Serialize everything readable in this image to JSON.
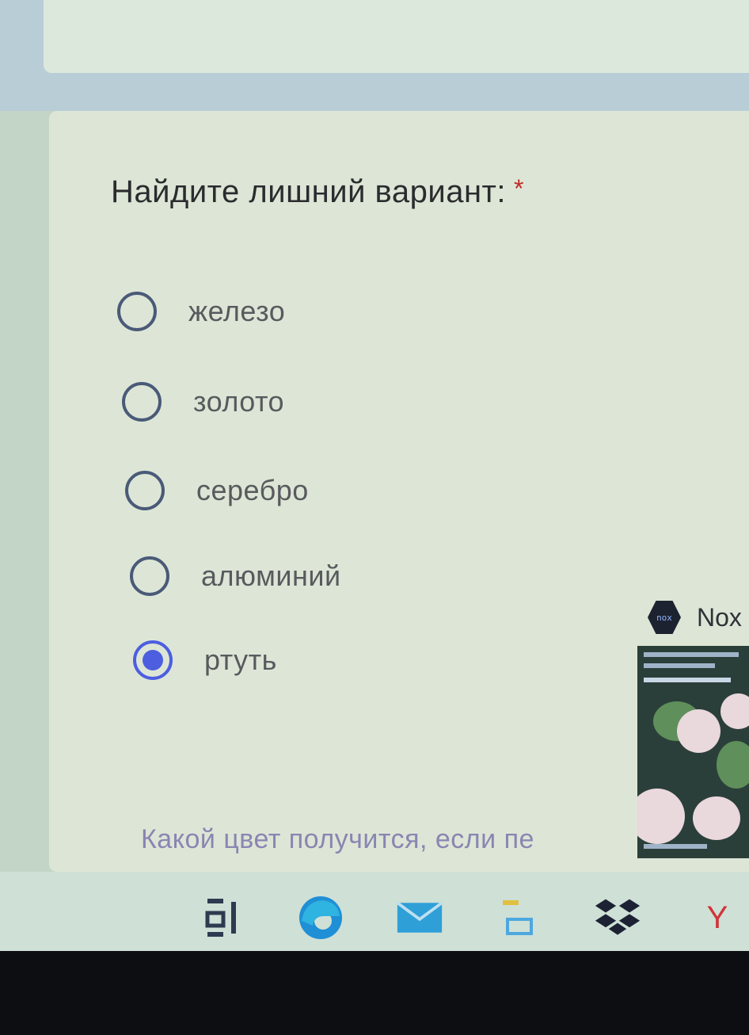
{
  "question": {
    "text": "Найдите лишний вариант:",
    "required_marker": "*"
  },
  "options": [
    {
      "label": "железо",
      "selected": false
    },
    {
      "label": "золото",
      "selected": false
    },
    {
      "label": "серебро",
      "selected": false
    },
    {
      "label": "алюминий",
      "selected": false
    },
    {
      "label": "ртуть",
      "selected": true
    }
  ],
  "next_question": {
    "text": "Какой цвет получится, если пе"
  },
  "notification": {
    "app_name": "Nox"
  },
  "taskbar": {
    "icons": [
      "task-view-icon",
      "edge-icon",
      "mail-icon",
      "file-explorer-icon",
      "dropbox-icon",
      "yandex-icon"
    ],
    "yandex_glyph": "Y"
  },
  "colors": {
    "accent": "#4d5ee0",
    "required": "#c22a2a",
    "card_background": "#dde6d6"
  }
}
